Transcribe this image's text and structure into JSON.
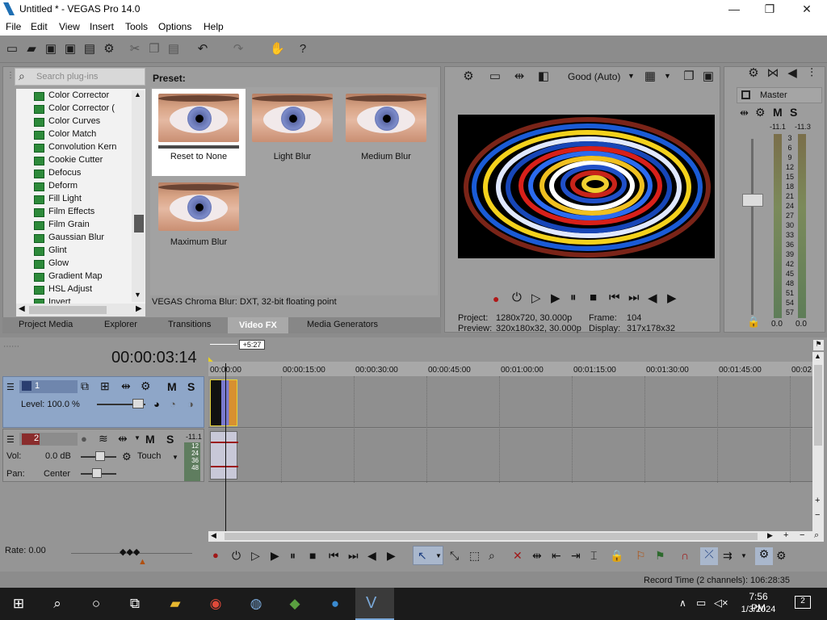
{
  "window": {
    "title": "Untitled * - VEGAS Pro 14.0",
    "minimize": "—",
    "maximize": "❐",
    "close": "✕"
  },
  "menu": [
    "File",
    "Edit",
    "View",
    "Insert",
    "Tools",
    "Options",
    "Help"
  ],
  "plugins": {
    "search_placeholder": "Search plug-ins",
    "items": [
      "Color Corrector",
      "Color Corrector (",
      "Color Curves",
      "Color Match",
      "Convolution Kern",
      "Cookie Cutter",
      "Defocus",
      "Deform",
      "Fill Light",
      "Film Effects",
      "Film Grain",
      "Gaussian Blur",
      "Glint",
      "Glow",
      "Gradient Map",
      "HSL Adjust",
      "Invert"
    ]
  },
  "presets": {
    "label": "Preset:",
    "items": [
      "Reset to None",
      "Light Blur",
      "Medium Blur",
      "Maximum Blur"
    ],
    "footer": "VEGAS Chroma Blur: DXT, 32-bit floating point"
  },
  "tabs": [
    "Project Media",
    "Explorer",
    "Transitions",
    "Video FX",
    "Media Generators"
  ],
  "preview": {
    "quality": "Good (Auto)",
    "project_label": "Project:",
    "project_val": "1280x720, 30.000p",
    "frame_label": "Frame:",
    "frame_val": "104",
    "preview_label": "Preview:",
    "preview_val": "320x180x32, 30.000p",
    "display_label": "Display:",
    "display_val": "317x178x32"
  },
  "master": {
    "label": "Master",
    "m": "M",
    "s": "S",
    "left_peak": "-11.1",
    "right_peak": "-11.3",
    "scale": [
      "3",
      "6",
      "9",
      "12",
      "15",
      "18",
      "21",
      "24",
      "27",
      "30",
      "33",
      "36",
      "39",
      "42",
      "45",
      "48",
      "51",
      "54",
      "57"
    ],
    "left_bottom": "0.0",
    "right_bottom": "0.0"
  },
  "timeline": {
    "timecode": "00:00:03:14",
    "marker": "+5:27",
    "ruler": [
      "00:00:00",
      "00:00:15:00",
      "00:00:30:00",
      "00:00:45:00",
      "00:01:00:00",
      "00:01:15:00",
      "00:01:30:00",
      "00:01:45:00",
      "00:02"
    ],
    "rate": "Rate: 0.00"
  },
  "track1": {
    "num": "1",
    "level": "Level: 100.0 %",
    "m": "M",
    "s": "S"
  },
  "track2": {
    "num": "2",
    "vol_label": "Vol:",
    "vol": "0.0 dB",
    "pan_label": "Pan:",
    "pan": "Center",
    "touch": "Touch",
    "m": "M",
    "s": "S",
    "peak": "-11.1",
    "meter": [
      "12",
      "24",
      "36",
      "48"
    ]
  },
  "status": {
    "record_time": "Record Time (2 channels): 106:28:35"
  },
  "taskbar": {
    "time": "7:56 PM",
    "date": "1/3/2024",
    "notif": "2"
  }
}
